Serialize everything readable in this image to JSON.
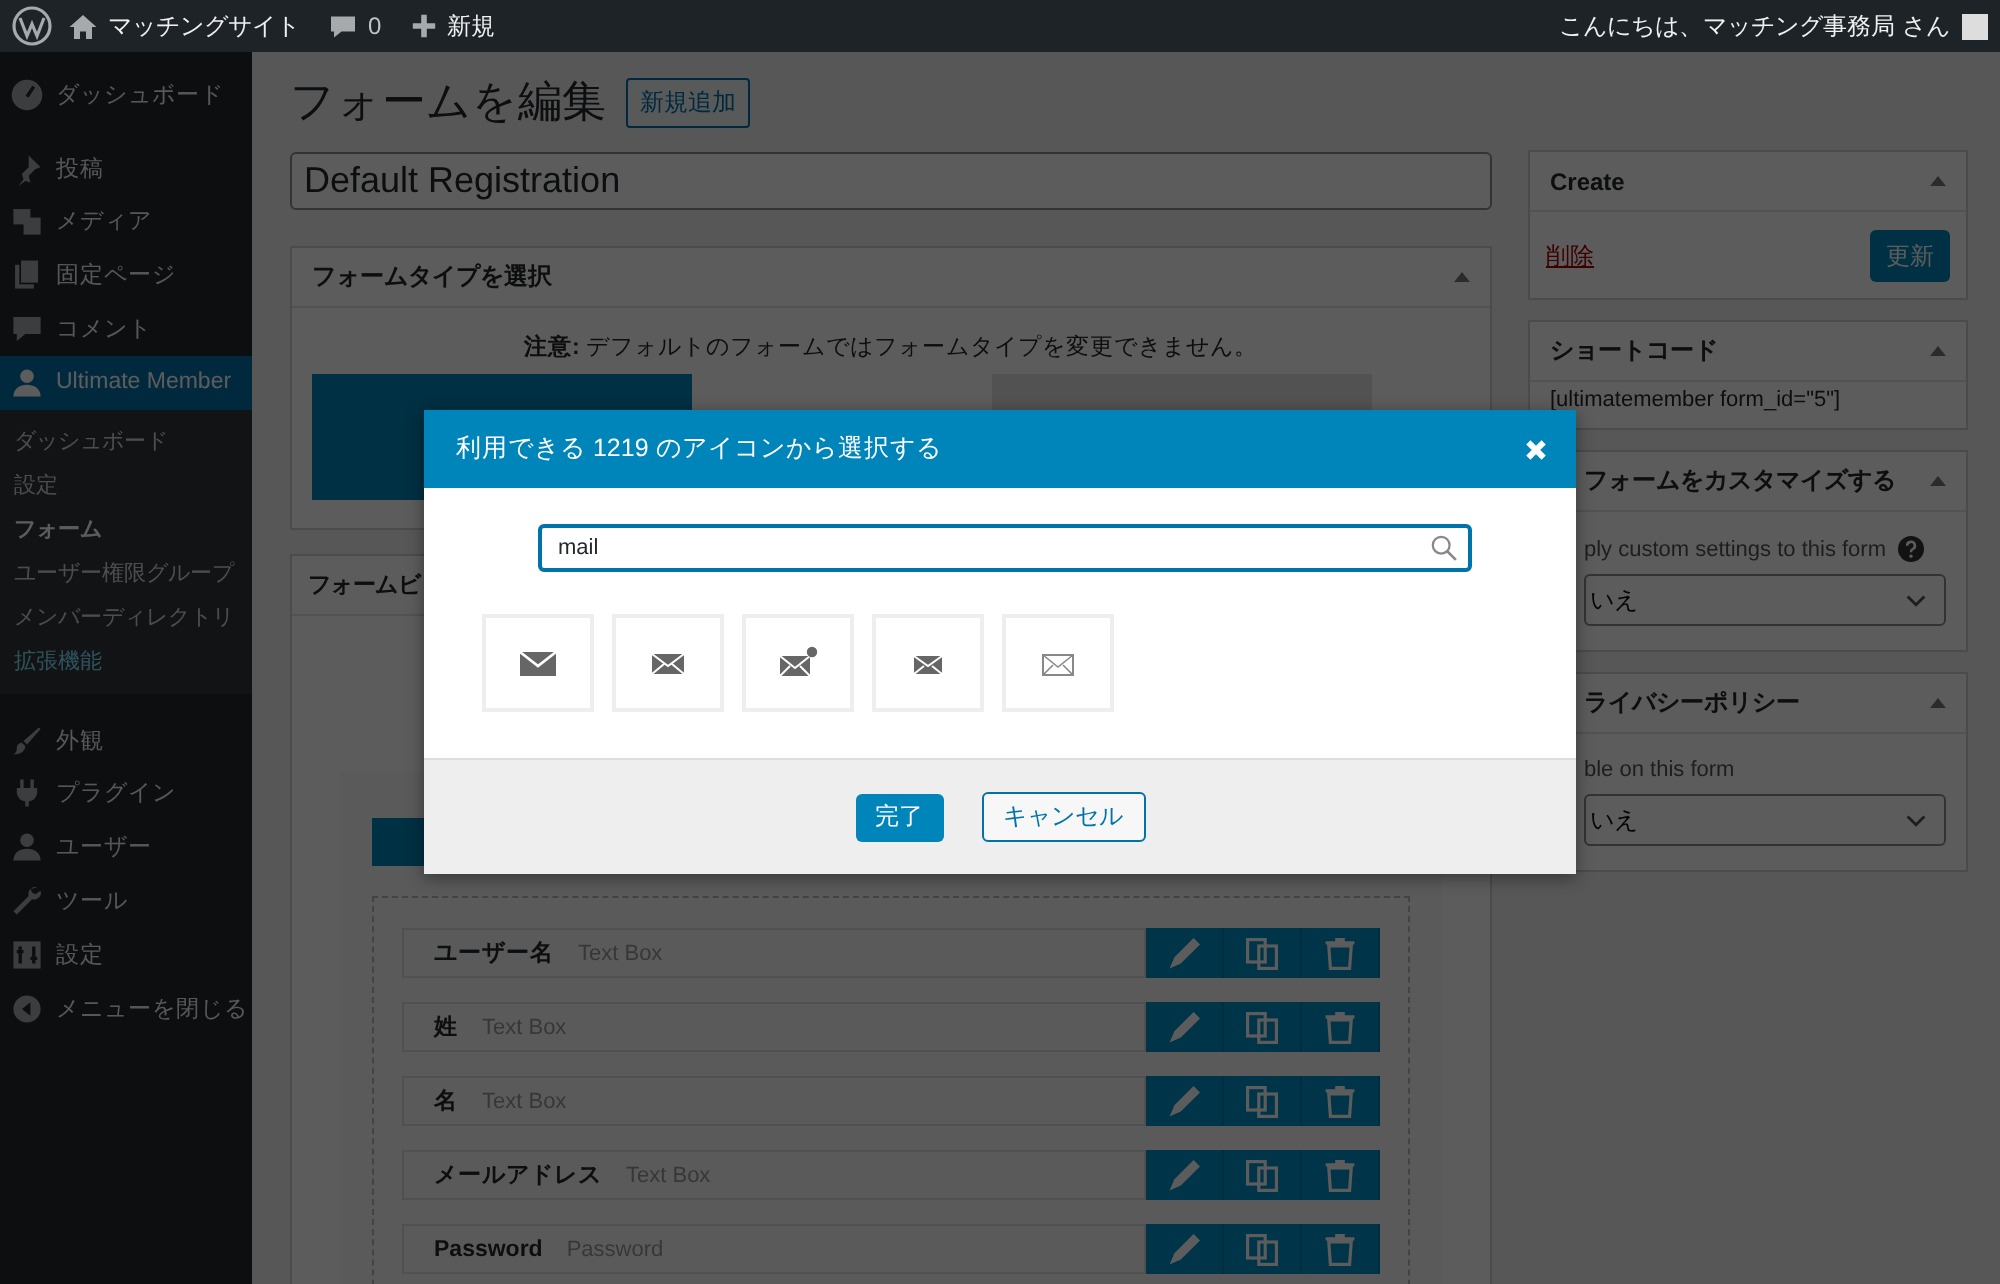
{
  "admin_bar": {
    "site_name": "マッチングサイト",
    "comments": "0",
    "new": "新規",
    "greeting": "こんにちは、マッチング事務局 さん"
  },
  "menu": [
    {
      "label": "ダッシュボード",
      "selected": false
    },
    {
      "label": "投稿",
      "selected": false
    },
    {
      "label": "メディア",
      "selected": false
    },
    {
      "label": "固定ページ",
      "selected": false
    },
    {
      "label": "コメント",
      "selected": false
    },
    {
      "label": "Ultimate Member",
      "selected": true,
      "children": [
        {
          "label": "ダッシュボード",
          "selected": false,
          "highlighted": false
        },
        {
          "label": "設定",
          "selected": false,
          "highlighted": false
        },
        {
          "label": "フォーム",
          "selected": true,
          "highlighted": false
        },
        {
          "label": "ユーザー権限グループ",
          "selected": false,
          "highlighted": false
        },
        {
          "label": "メンバーディレクトリ",
          "selected": false,
          "highlighted": false
        },
        {
          "label": "拡張機能",
          "selected": false,
          "highlighted": true
        }
      ]
    },
    {
      "label": "外観",
      "selected": false
    },
    {
      "label": "プラグイン",
      "selected": false
    },
    {
      "label": "ユーザー",
      "selected": false
    },
    {
      "label": "ツール",
      "selected": false
    },
    {
      "label": "設定",
      "selected": false
    },
    {
      "label": "メニューを閉じる",
      "selected": false
    }
  ],
  "page": {
    "title": "フォームを編集",
    "add_new": "新規追加",
    "form_title": "Default Registration",
    "form_type_panel": {
      "title": "フォームタイプを選択",
      "notice": "**注意:** デフォルトのフォームではフォームタイプを変更できません。"
    },
    "builder_panel": {
      "title": "フォームビ",
      "fields": [
        {
          "label": "ユーザー名",
          "type": "Text Box"
        },
        {
          "label": "姓",
          "type": "Text Box"
        },
        {
          "label": "名",
          "type": "Text Box"
        },
        {
          "label": "メールアドレス",
          "type": "Text Box"
        },
        {
          "label": "Password",
          "type": "Password"
        }
      ]
    }
  },
  "sidebar": {
    "create": {
      "title": "Create",
      "delete": "削除",
      "update": "更新"
    },
    "shortcode": {
      "title": "ショートコード",
      "code": "[ultimatemember form_id=\"5\"]"
    },
    "customize": {
      "title": "フォームをカスタマイズする",
      "label": "ply custom settings to this form",
      "value": "いえ"
    },
    "privacy": {
      "title": "ライバシーポリシー",
      "label": "ble on this form",
      "value": "いえ"
    }
  },
  "modal": {
    "title": "利用できる 1219 のアイコンから選択する",
    "search": {
      "value": "mail"
    },
    "icons": [
      {
        "selected": false
      },
      {
        "selected": false
      },
      {
        "selected": false
      },
      {
        "selected": false
      },
      {
        "selected": false
      }
    ],
    "buttons": {
      "done": "完了",
      "cancel": "キャンセル"
    }
  }
}
